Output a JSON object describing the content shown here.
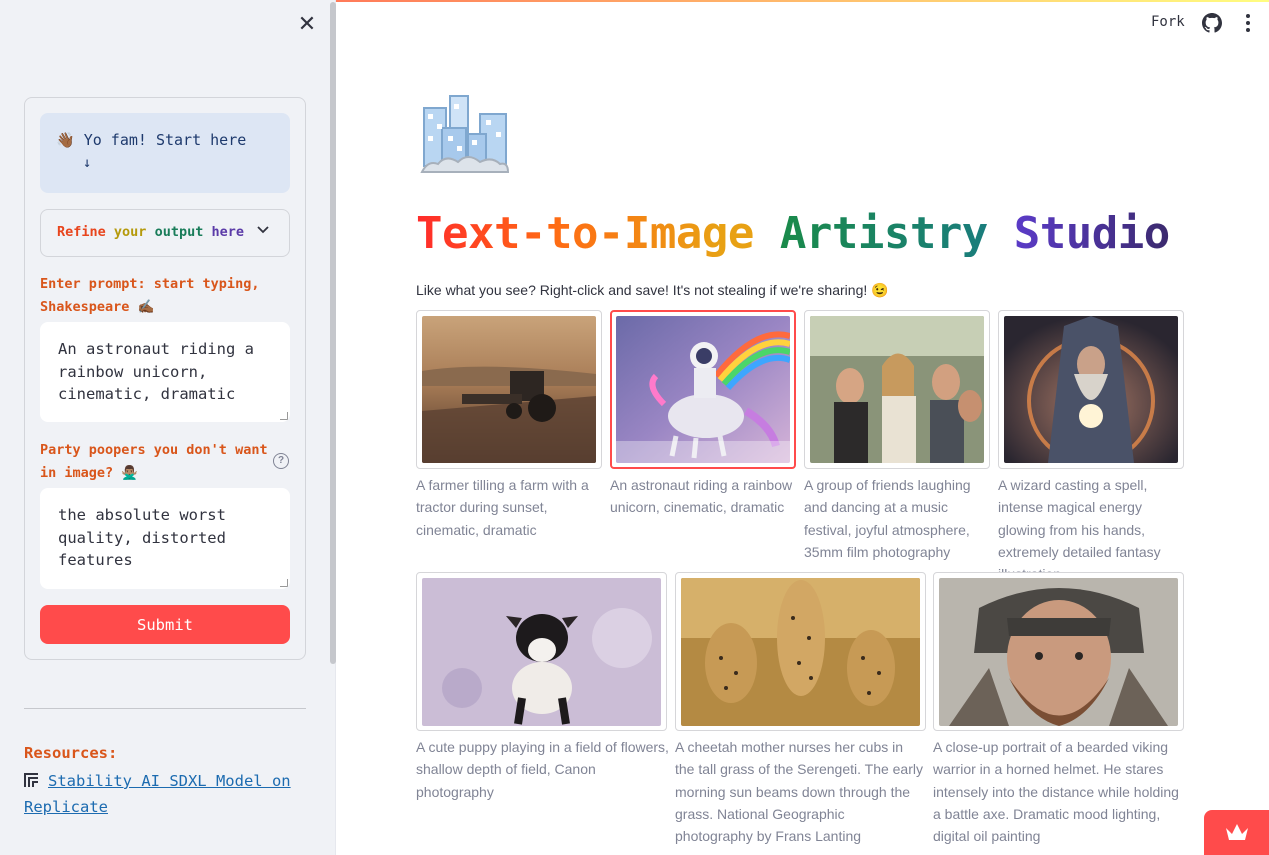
{
  "sidebar": {
    "close_icon": "close-icon",
    "info_wave": "👋🏾",
    "info_text": "Yo fam! Start here",
    "info_arrow": "↓",
    "expander": {
      "words": [
        "Refine",
        "your",
        "output",
        "here"
      ],
      "chevron_icon": "chevron-down-icon"
    },
    "prompt_label": "Enter prompt: start typing, Shakespeare ✍🏾",
    "prompt_value": "An astronaut riding a rainbow unicorn, cinematic, dramatic",
    "negative_label": "Party poopers you don't want in image? 🙅🏽‍♂️",
    "negative_value": "the absolute worst quality, distorted features",
    "help_icon": "help-circle-icon",
    "submit_label": "Submit",
    "resources_title": "Resources:",
    "resources_link": "Stability AI SDXL Model on Replicate"
  },
  "header": {
    "fork_label": "Fork",
    "github_icon": "github-icon",
    "menu_icon": "kebab-menu-icon"
  },
  "main": {
    "title_parts": [
      "Text-to-Image",
      "Artistry",
      "Studio"
    ],
    "subtitle": "Like what you see? Right-click and save! It's not stealing if we're sharing! 😉",
    "gallery": [
      {
        "caption": "A farmer tilling a farm with a tractor during sunset, cinematic, dramatic",
        "selected": false
      },
      {
        "caption": "An astronaut riding a rainbow unicorn, cinematic, dramatic",
        "selected": true
      },
      {
        "caption": "A group of friends laughing and dancing at a music festival, joyful atmosphere, 35mm film photography",
        "selected": false
      },
      {
        "caption": "A wizard casting a spell, intense magical energy glowing from his hands, extremely detailed fantasy illustration",
        "selected": false
      },
      {
        "caption": "A cute puppy playing in a field of flowers, shallow depth of field, Canon photography",
        "selected": false
      },
      {
        "caption": "A cheetah mother nurses her cubs in the tall grass of the Serengeti. The early morning sun beams down through the grass. National Geographic photography by Frans Lanting",
        "selected": false
      },
      {
        "caption": "A close-up portrait of a bearded viking warrior in a horned helmet. He stares intensely into the distance while holding a battle axe. Dramatic mood lighting, digital oil painting",
        "selected": false
      }
    ]
  },
  "colors": {
    "accent": "#ff4b4b",
    "sidebar_bg": "#f0f2f6",
    "label_orange": "#d9561b",
    "link_blue": "#1c6bb0"
  }
}
